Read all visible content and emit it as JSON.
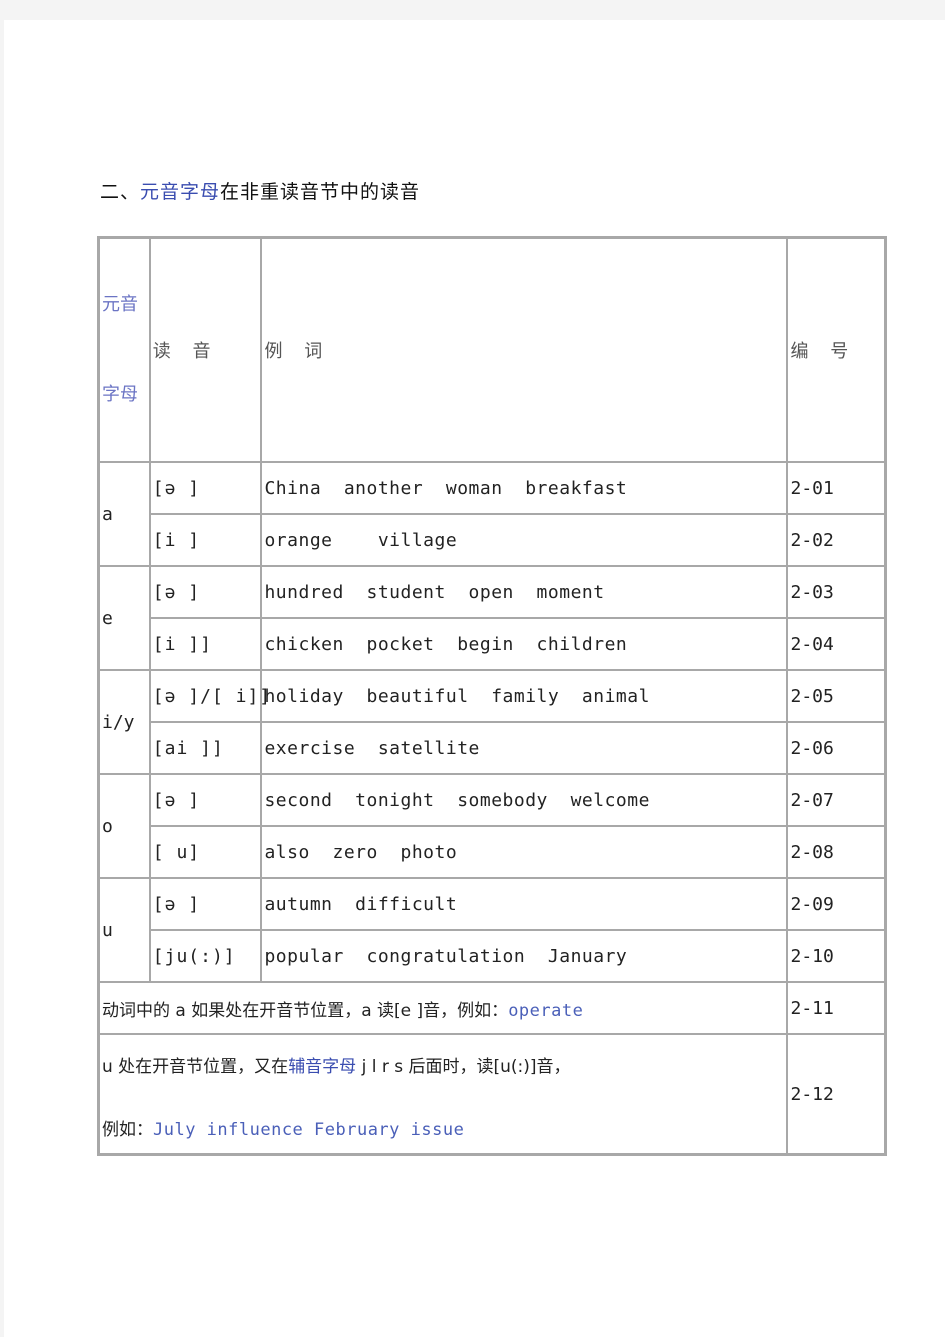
{
  "heading": {
    "prefix": "二、",
    "highlight": "元音字母",
    "suffix": "在非重读音节中的读音"
  },
  "table": {
    "headers": {
      "vowel_line1": "元音",
      "vowel_line2": "字母",
      "pronunciation": "读 音",
      "examples": "例 词",
      "code": "编 号"
    },
    "groups": [
      {
        "letter": "a",
        "rows": [
          {
            "phonetic": "[ə ]",
            "examples": "China  another  woman  breakfast",
            "code": "2-01"
          },
          {
            "phonetic": "[i ]",
            "examples": "orange    village",
            "code": "2-02"
          }
        ]
      },
      {
        "letter": "e",
        "rows": [
          {
            "phonetic": "[ə ]",
            "examples": "hundred  student  open  moment",
            "code": "2-03"
          },
          {
            "phonetic": "[i ]]",
            "examples": "chicken  pocket  begin  children",
            "code": "2-04"
          }
        ]
      },
      {
        "letter": "i/y",
        "rows": [
          {
            "phonetic": "[ə ]/[ i]]",
            "examples": "holiday  beautiful  family  animal",
            "code": "2-05"
          },
          {
            "phonetic": "[ai ]]",
            "examples": "exercise  satellite",
            "code": "2-06"
          }
        ]
      },
      {
        "letter": "o",
        "rows": [
          {
            "phonetic": "[ə ]",
            "examples": "second  tonight  somebody  welcome",
            "code": "2-07"
          },
          {
            "phonetic": "[ u]",
            "examples": "also  zero  photo",
            "code": "2-08"
          }
        ]
      },
      {
        "letter": "u",
        "rows": [
          {
            "phonetic": "[ə ]",
            "examples": "autumn  difficult",
            "code": "2-09"
          },
          {
            "phonetic": "[ju(:)]",
            "examples": "popular  congratulation  January",
            "code": "2-10"
          }
        ]
      }
    ],
    "notes": [
      {
        "text": "动词中的 a 如果处在开音节位置，a 读[e ]音，例如：",
        "example": "operate",
        "code": "2-11"
      },
      {
        "text_before": "u 处在开音节位置，又在",
        "highlight": "辅音字母",
        "text_after": " j l r s 后面时，读[u(:)]音，",
        "example_label": "例如：",
        "example": "July influence February issue",
        "code": "2-12"
      }
    ]
  }
}
